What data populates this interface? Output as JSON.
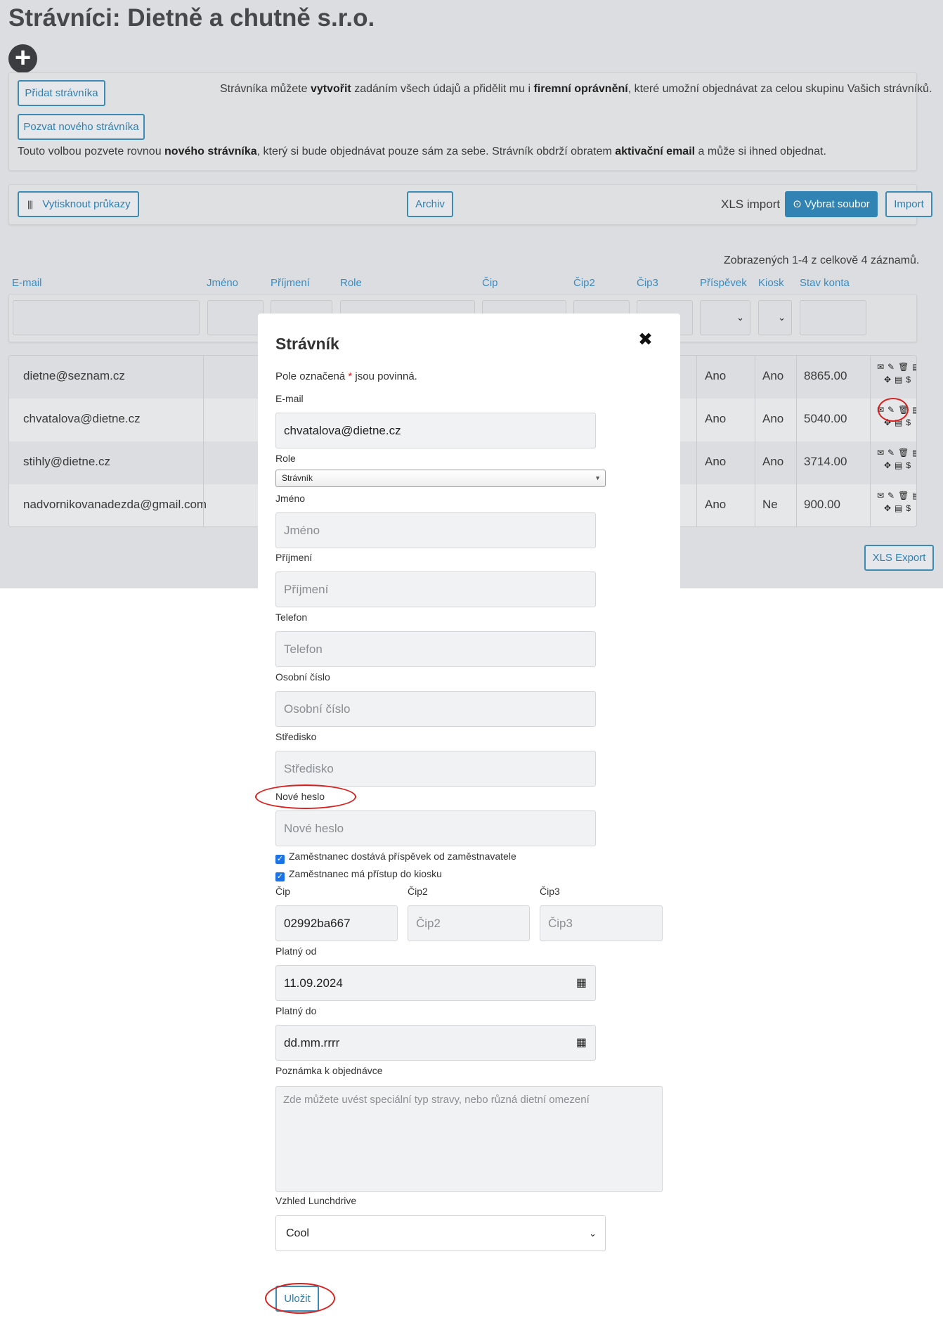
{
  "page": {
    "title": "Strávníci: Dietně a chutně s.r.o.",
    "add_icon": "plus-circle-icon"
  },
  "info_panel": {
    "add_button": "Přidat strávníka",
    "invite_button": "Pozvat nového strávníka",
    "create_text_1": "Strávníka můžete ",
    "create_text_b1": "vytvořit",
    "create_text_2": " zadáním všech údajů a přidělit mu i ",
    "create_text_b2": "firemní oprávnění",
    "create_text_3": ", které umožní objednávat za celou skupinu Vašich strávníků.",
    "invite_text_1": "Touto volbou pozvete rovnou ",
    "invite_text_b1": "nového strávníka",
    "invite_text_2": ", který si bude objednávat pouze sám za sebe. Strávník obdrží obratem ",
    "invite_text_b2": "aktivační email",
    "invite_text_3": " a může si ihned objednat."
  },
  "toolbar": {
    "print_button": "Vytisknout průkazy",
    "print_icon": "barcode-icon",
    "archive_button": "Archiv",
    "xls_import_label": "XLS import",
    "choose_file_button": "Vybrat soubor",
    "choose_file_icon": "upload-icon",
    "import_button": "Import"
  },
  "table": {
    "summary": "Zobrazených 1-4 z celkově 4 záznamů.",
    "columns": [
      "E-mail",
      "Jméno",
      "Příjmení",
      "Role",
      "Čip",
      "Čip2",
      "Čip3",
      "Příspěvek",
      "Kiosk",
      "Stav konta"
    ],
    "rows": [
      {
        "email": "dietne@seznam.cz",
        "prispevek": "Ano",
        "kiosk": "Ano",
        "stav": "8865.00"
      },
      {
        "email": "chvatalova@dietne.cz",
        "prispevek": "Ano",
        "kiosk": "Ano",
        "stav": "5040.00"
      },
      {
        "email": "stihly@dietne.cz",
        "prispevek": "Ano",
        "kiosk": "Ano",
        "stav": "3714.00"
      },
      {
        "email": "nadvornikovanadezda@gmail.com",
        "prispevek": "Ano",
        "kiosk": "Ne",
        "stav": "900.00"
      }
    ],
    "row_icons_top": "✉✎🗑▤",
    "row_icons_bottom": "✥▤$",
    "row_icon_names": [
      "envelope-icon",
      "pencil-icon",
      "trash-icon",
      "list-icon",
      "move-icon",
      "stack-icon",
      "dollar-icon"
    ],
    "xls_export_button": "XLS Export"
  },
  "modal": {
    "title": "Strávník",
    "close_icon": "close-icon",
    "required_note_1": "Pole označená ",
    "required_star": "*",
    "required_note_2": " jsou povinná.",
    "email_label": "E-mail",
    "email_value": "chvatalova@dietne.cz",
    "role_label": "Role",
    "role_value": "Strávník",
    "jmeno_label": "Jméno",
    "jmeno_placeholder": "Jméno",
    "prijmeni_label": "Příjmení",
    "prijmeni_placeholder": "Příjmení",
    "telefon_label": "Telefon",
    "telefon_placeholder": "Telefon",
    "osobni_label": "Osobní číslo",
    "osobni_placeholder": "Osobní číslo",
    "stredisko_label": "Středisko",
    "stredisko_placeholder": "Středisko",
    "heslo_label": "Nové heslo",
    "heslo_placeholder": "Nové heslo",
    "check_prispevek": "Zaměstnanec dostává příspěvek od zaměstnavatele",
    "check_kiosk": "Zaměstnanec má přístup do kiosku",
    "cip_label": "Čip",
    "cip_value": "02992ba667",
    "cip2_label": "Čip2",
    "cip2_placeholder": "Čip2",
    "cip3_label": "Čip3",
    "cip3_placeholder": "Čip3",
    "platny_od_label": "Platný od",
    "platny_od_value": "11.09.2024",
    "platny_do_label": "Platný do",
    "platny_do_value": "dd.mm.rrrr",
    "calendar_icon": "calendar-icon",
    "poznamka_label": "Poznámka k objednávce",
    "poznamka_placeholder": "Zde můžete uvést speciální typ stravy, nebo různá dietní omezení",
    "vzhled_label": "Vzhled Lunchdrive",
    "vzhled_value": "Cool",
    "save_button": "Uložit"
  },
  "colors": {
    "accent": "#3083b3",
    "link": "#3a8bbf",
    "highlight": "#d9201e",
    "backdrop": "#dcdde0"
  }
}
